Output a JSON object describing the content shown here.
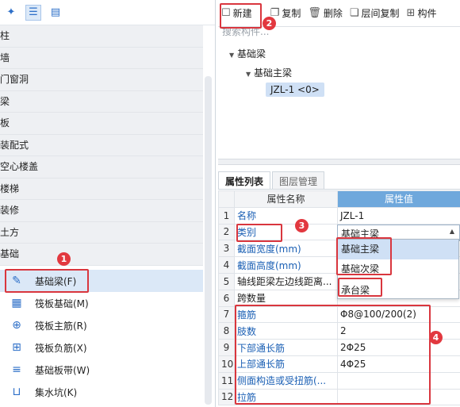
{
  "left_toolbar": {
    "icons": [
      "pin-icon",
      "list-view-icon",
      "detail-view-icon"
    ]
  },
  "categories": [
    {
      "label": "柱"
    },
    {
      "label": "墙"
    },
    {
      "label": "门窗洞"
    },
    {
      "label": "梁"
    },
    {
      "label": "板"
    },
    {
      "label": "装配式"
    },
    {
      "label": "空心楼盖"
    },
    {
      "label": "楼梯"
    },
    {
      "label": "装修"
    },
    {
      "label": "土方"
    },
    {
      "label": "基础"
    }
  ],
  "sub_items": [
    {
      "label": "基础梁(F)",
      "icon": "foundation-beam-icon",
      "active": true
    },
    {
      "label": "筏板基础(M)",
      "icon": "raft-foundation-icon"
    },
    {
      "label": "筏板主筋(R)",
      "icon": "raft-main-rebar-icon"
    },
    {
      "label": "筏板负筋(X)",
      "icon": "raft-negative-rebar-icon"
    },
    {
      "label": "基础板带(W)",
      "icon": "foundation-strip-icon"
    },
    {
      "label": "集水坑(K)",
      "icon": "sump-pit-icon"
    }
  ],
  "right_toolbar": {
    "new_label": "新建",
    "copy_label": "复制",
    "delete_label": "删除",
    "floor_copy_label": "层间复制",
    "component_label": "构件"
  },
  "search": {
    "placeholder": "搜索构件..."
  },
  "tree": {
    "root": "基础梁",
    "child": "基础主梁",
    "selected": "JZL-1 <0>"
  },
  "tabs": {
    "properties": "属性列表",
    "layers": "图层管理"
  },
  "table": {
    "header_name": "属性名称",
    "header_value": "属性值",
    "rows": [
      {
        "n": "1",
        "name": "名称",
        "value": "JZL-1"
      },
      {
        "n": "2",
        "name": "类别",
        "value": "基础主梁"
      },
      {
        "n": "3",
        "name": "截面宽度(mm)",
        "value": ""
      },
      {
        "n": "4",
        "name": "截面高度(mm)",
        "value": ""
      },
      {
        "n": "5",
        "name": "轴线距梁左边线距离...",
        "value": ""
      },
      {
        "n": "6",
        "name": "跨数量",
        "value": ""
      },
      {
        "n": "7",
        "name": "箍筋",
        "value": "Φ8@100/200(2)"
      },
      {
        "n": "8",
        "name": "肢数",
        "value": "2"
      },
      {
        "n": "9",
        "name": "下部通长筋",
        "value": "2Φ25"
      },
      {
        "n": "10",
        "name": "上部通长筋",
        "value": "4Φ25"
      },
      {
        "n": "11",
        "name": "侧面构造或受扭筋(...",
        "value": ""
      },
      {
        "n": "12",
        "name": "拉筋",
        "value": ""
      }
    ]
  },
  "dropdown": {
    "current": "基础主梁",
    "options": [
      "基础主梁",
      "基础次梁",
      "承台梁"
    ]
  },
  "annotations": [
    "1",
    "2",
    "3",
    "4"
  ],
  "colors": {
    "accent": "#2d6fc8",
    "annotation": "#d9363e",
    "header_value_bg": "#6fa8dc"
  }
}
